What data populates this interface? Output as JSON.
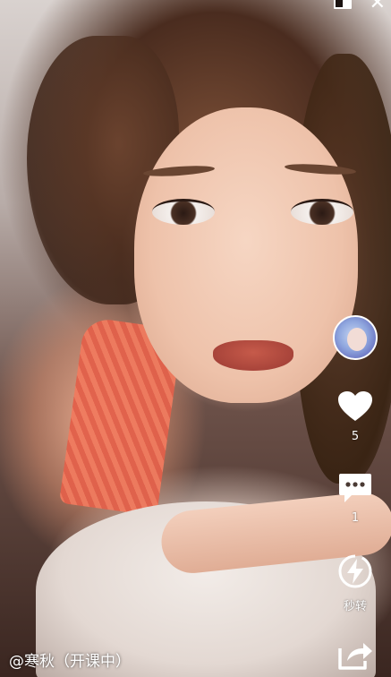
{
  "video": {
    "caption": "@寒秋（开课中）"
  },
  "top_bar": {
    "close_glyph": "✕"
  },
  "actions": {
    "like_count": "5",
    "comment_count": "1",
    "flash_label": "秒转"
  },
  "colors": {
    "icon_white": "#ffffff",
    "avatar_tint": "#8fa6de"
  }
}
